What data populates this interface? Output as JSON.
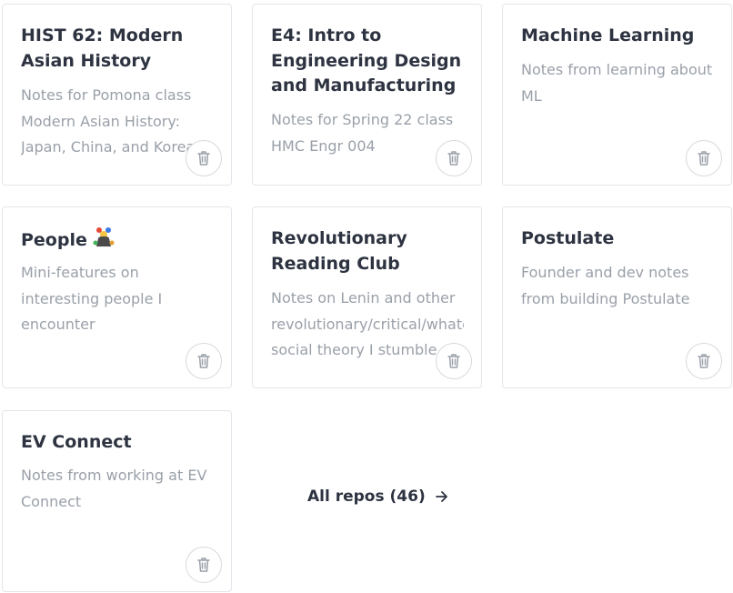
{
  "repos": [
    {
      "title": "HIST 62: Modern Asian History",
      "title_lines": [
        "HIST 62: Modern",
        "Asian History"
      ],
      "desc_lines": [
        "Notes for Pomona class",
        "Modern Asian History:",
        "Japan, China, and Korea."
      ]
    },
    {
      "title_lines": [
        "E4: Intro to",
        "Engineering Design",
        "and Manufacturing"
      ],
      "desc_lines": [
        "Notes for Spring 22 class",
        "HMC Engr 004"
      ]
    },
    {
      "title_lines": [
        "Machine Learning"
      ],
      "desc_lines": [
        "Notes from learning about",
        "ML"
      ]
    },
    {
      "title_lines": [
        "People"
      ],
      "title_icon": "juggler-emoji-icon",
      "desc_lines": [
        "Mini-features on",
        "interesting people I",
        "encounter"
      ]
    },
    {
      "title_lines": [
        "Revolutionary",
        "Reading Club"
      ],
      "desc_lines": [
        "Notes on Lenin and other",
        "revolutionary/critical/whatever",
        "social theory I stumble..."
      ]
    },
    {
      "title_lines": [
        "Postulate"
      ],
      "desc_lines": [
        "Founder and dev notes",
        "from building Postulate"
      ]
    },
    {
      "title_lines": [
        "EV Connect"
      ],
      "desc_lines": [
        "Notes from working at EV",
        "Connect"
      ]
    }
  ],
  "all_repos": {
    "label": "All repos (46)",
    "icon": "arrow-right-icon"
  },
  "icons": {
    "delete": "trash-icon"
  },
  "colors": {
    "title": "#2d3340",
    "description": "#9aa0a9",
    "border": "#e3e5ea"
  }
}
